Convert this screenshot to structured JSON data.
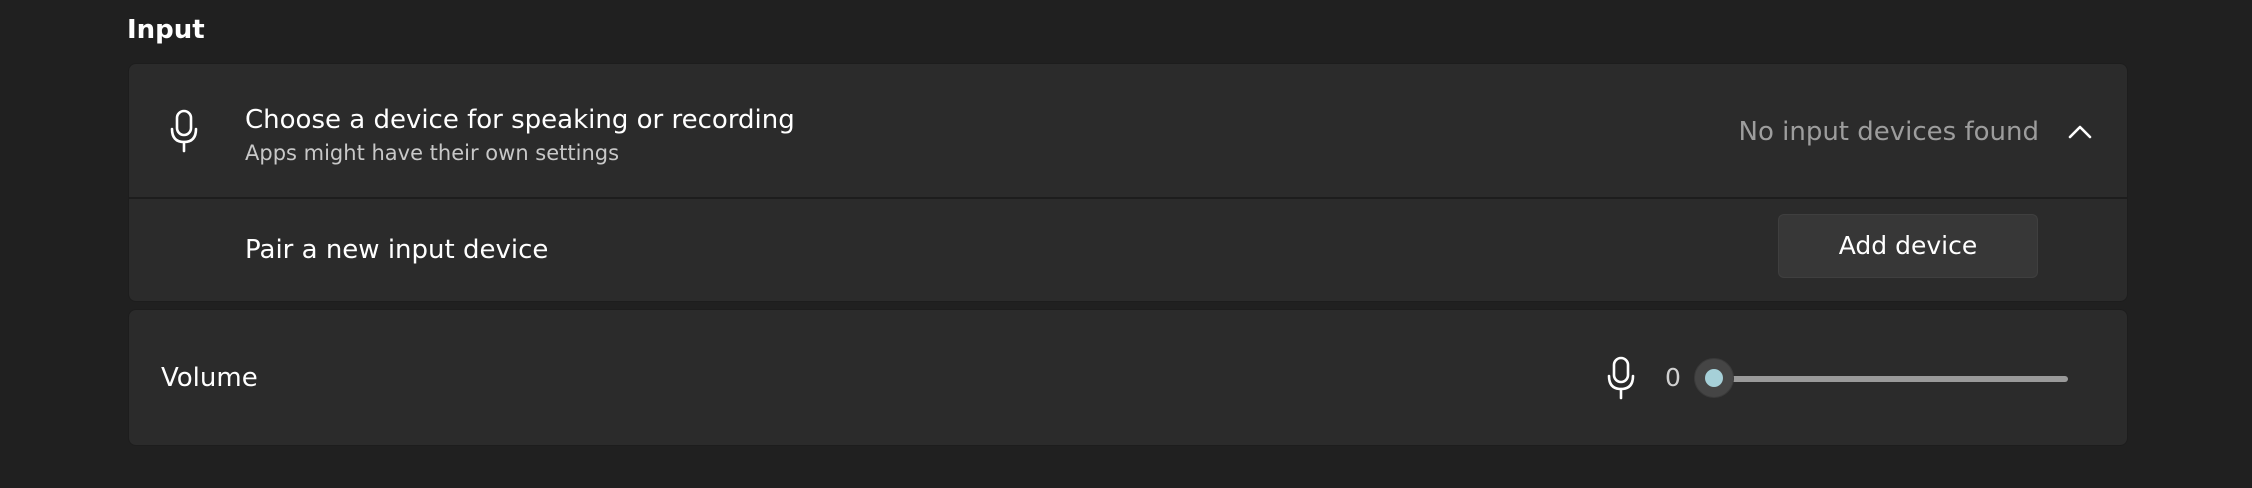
{
  "section": {
    "title": "Input"
  },
  "input_device": {
    "title": "Choose a device for speaking or recording",
    "subtitle": "Apps might have their own settings",
    "status": "No input devices found",
    "icon": "microphone-icon",
    "expanded_icon": "chevron-up-icon"
  },
  "pair": {
    "label": "Pair a new input device",
    "button_label": "Add device"
  },
  "volume": {
    "label": "Volume",
    "value": "0",
    "level_percent": 0,
    "icon": "microphone-icon"
  },
  "colors": {
    "background": "#202020",
    "card": "#2b2b2b",
    "accent": "#a6d0d8"
  }
}
